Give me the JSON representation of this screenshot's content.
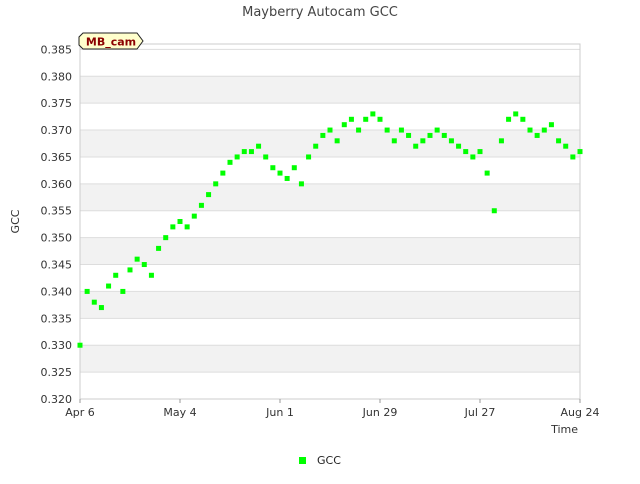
{
  "chart_data": {
    "type": "scatter",
    "title": "Mayberry Autocam GCC",
    "badge": "MB_cam",
    "xlabel": "Time",
    "ylabel": "GCC",
    "x_ticks": [
      "Apr 6",
      "May 4",
      "Jun 1",
      "Jun 29",
      "Jul 27",
      "Aug 24"
    ],
    "xlim": [
      "2021-04-06",
      "2021-08-24"
    ],
    "y_ticks": [
      "0.320",
      "0.325",
      "0.330",
      "0.335",
      "0.340",
      "0.345",
      "0.350",
      "0.355",
      "0.360",
      "0.365",
      "0.370",
      "0.375",
      "0.380",
      "0.385"
    ],
    "ylim": [
      0.32,
      0.386
    ],
    "grid": true,
    "legend_position": "bottom-center",
    "colors": {
      "series": "#00ff00",
      "band": "#f2f2f2",
      "badge_bg": "#ffffcc",
      "badge_text": "#8b0000"
    },
    "series": [
      {
        "name": "GCC",
        "x": [
          "2021-04-06",
          "2021-04-08",
          "2021-04-10",
          "2021-04-12",
          "2021-04-14",
          "2021-04-16",
          "2021-04-18",
          "2021-04-20",
          "2021-04-22",
          "2021-04-24",
          "2021-04-26",
          "2021-04-28",
          "2021-04-30",
          "2021-05-02",
          "2021-05-04",
          "2021-05-06",
          "2021-05-08",
          "2021-05-10",
          "2021-05-12",
          "2021-05-14",
          "2021-05-16",
          "2021-05-18",
          "2021-05-20",
          "2021-05-22",
          "2021-05-24",
          "2021-05-26",
          "2021-05-28",
          "2021-05-30",
          "2021-06-01",
          "2021-06-03",
          "2021-06-05",
          "2021-06-07",
          "2021-06-09",
          "2021-06-11",
          "2021-06-13",
          "2021-06-15",
          "2021-06-17",
          "2021-06-19",
          "2021-06-21",
          "2021-06-23",
          "2021-06-25",
          "2021-06-27",
          "2021-06-29",
          "2021-07-01",
          "2021-07-03",
          "2021-07-05",
          "2021-07-07",
          "2021-07-09",
          "2021-07-11",
          "2021-07-13",
          "2021-07-15",
          "2021-07-17",
          "2021-07-19",
          "2021-07-21",
          "2021-07-23",
          "2021-07-25",
          "2021-07-27",
          "2021-07-29",
          "2021-07-31",
          "2021-08-02",
          "2021-08-04",
          "2021-08-06",
          "2021-08-08",
          "2021-08-10",
          "2021-08-12",
          "2021-08-14",
          "2021-08-16",
          "2021-08-18",
          "2021-08-20",
          "2021-08-22",
          "2021-08-24"
        ],
        "y": [
          0.33,
          0.34,
          0.338,
          0.337,
          0.341,
          0.343,
          0.34,
          0.344,
          0.346,
          0.345,
          0.343,
          0.348,
          0.35,
          0.352,
          0.353,
          0.352,
          0.354,
          0.356,
          0.358,
          0.36,
          0.362,
          0.364,
          0.365,
          0.366,
          0.366,
          0.367,
          0.365,
          0.363,
          0.362,
          0.361,
          0.363,
          0.36,
          0.365,
          0.367,
          0.369,
          0.37,
          0.368,
          0.371,
          0.372,
          0.37,
          0.372,
          0.373,
          0.372,
          0.37,
          0.368,
          0.37,
          0.369,
          0.367,
          0.368,
          0.369,
          0.37,
          0.369,
          0.368,
          0.367,
          0.366,
          0.365,
          0.366,
          0.362,
          0.355,
          0.368,
          0.372,
          0.373,
          0.372,
          0.37,
          0.369,
          0.37,
          0.371,
          0.368,
          0.367,
          0.365,
          0.366
        ]
      }
    ]
  }
}
